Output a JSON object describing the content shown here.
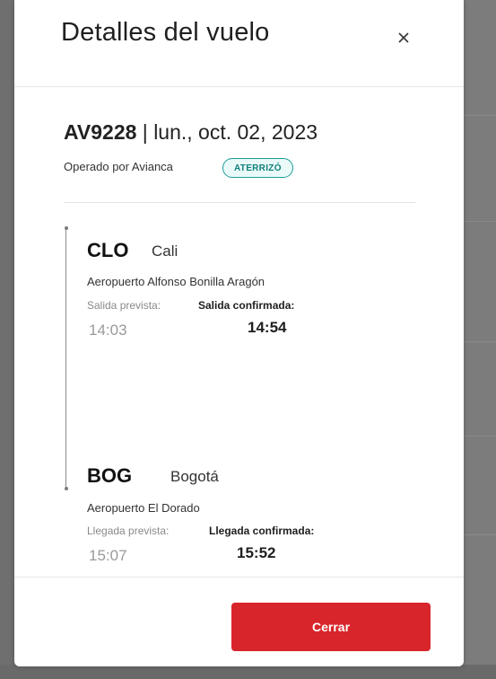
{
  "modal": {
    "title": "Detalles del vuelo",
    "close_icon": "close-icon"
  },
  "flight": {
    "number": "AV9228",
    "separator": " | ",
    "date": "lun., oct. 02, 2023",
    "operated_by": "Operado por Avianca",
    "status": "ATERRIZÓ",
    "status_color": "#1a9e99"
  },
  "departure": {
    "code": "CLO",
    "city": "Cali",
    "airport": "Aeropuerto Alfonso Bonilla Aragón",
    "planned_label": "Salida prevista:",
    "confirmed_label": "Salida confirmada:",
    "planned_time": "14:03",
    "confirmed_time": "14:54"
  },
  "arrival": {
    "code": "BOG",
    "city": "Bogotá",
    "airport": "Aeropuerto El Dorado",
    "planned_label": "Llegada prevista:",
    "confirmed_label": "Llegada confirmada:",
    "planned_time": "15:07",
    "confirmed_time": "15:52"
  },
  "footer": {
    "close_button": "Cerrar",
    "accent": "#d8252b"
  }
}
